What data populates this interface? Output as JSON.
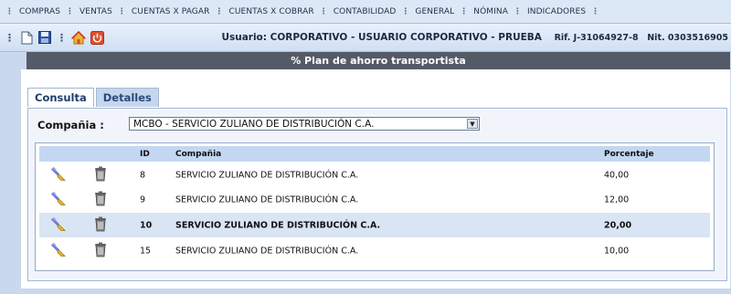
{
  "menu": {
    "items": [
      "COMPRAS",
      "VENTAS",
      "CUENTAS X PAGAR",
      "CUENTAS X COBRAR",
      "CONTABILIDAD",
      "GENERAL",
      "NÓMINA",
      "INDICADORES"
    ]
  },
  "toolbar": {
    "user_label": "Usuario: CORPORATIVO - USUARIO CORPORATIVO - PRUEBA",
    "rif_label": "Rif. J-31064927-8",
    "nit_label": "Nit. 0303516905"
  },
  "page": {
    "title": "% Plan de ahorro transportista"
  },
  "tabs": [
    {
      "label": "Consulta",
      "active": true
    },
    {
      "label": "Detalles",
      "active": false
    }
  ],
  "filter": {
    "label": "Compañia :",
    "selected": "MCBO - SERVICIO ZULIANO DE DISTRIBUCIÓN C.A."
  },
  "table": {
    "headers": {
      "id": "ID",
      "company": "Compañia",
      "percentage": "Porcentaje"
    },
    "rows": [
      {
        "id": "8",
        "company": "SERVICIO ZULIANO DE DISTRIBUCIÓN C.A.",
        "percentage": "40,00",
        "selected": false
      },
      {
        "id": "9",
        "company": "SERVICIO ZULIANO DE DISTRIBUCIÓN C.A.",
        "percentage": "12,00",
        "selected": false
      },
      {
        "id": "10",
        "company": "SERVICIO ZULIANO DE DISTRIBUCIÓN C.A.",
        "percentage": "20,00",
        "selected": true
      },
      {
        "id": "15",
        "company": "SERVICIO ZULIANO DE DISTRIBUCIÓN C.A.",
        "percentage": "10,00",
        "selected": false
      }
    ]
  },
  "icons": {
    "new": "new-document-icon",
    "save": "save-icon",
    "home": "home-icon",
    "exit": "power-icon",
    "edit": "edit-brush-icon",
    "delete": "trash-icon"
  },
  "colors": {
    "title_bar": "#555b66",
    "header_row": "#c4d7f2",
    "selected_row": "#d9e4f4",
    "background": "#c9d8ec"
  }
}
